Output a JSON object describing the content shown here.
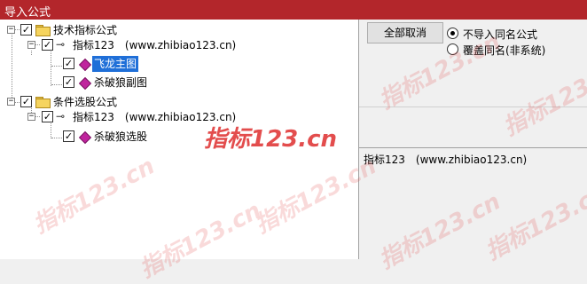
{
  "window": {
    "title": "导入公式"
  },
  "tree": {
    "nodes": [
      {
        "label": "技术指标公式"
      },
      {
        "label": "指标123　(www.zhibiao123.cn)"
      },
      {
        "label": "飞龙主图"
      },
      {
        "label": "杀破狼副图"
      },
      {
        "label": "条件选股公式"
      },
      {
        "label": "指标123　(www.zhibiao123.cn)"
      },
      {
        "label": "杀破狼选股"
      }
    ]
  },
  "actions": {
    "deselect_all_label": "全部取消"
  },
  "options": {
    "no_import_same_name": "不导入同名公式",
    "overwrite_same_name": "覆盖同名(非系统)",
    "selected": "no_import_same_name"
  },
  "info": {
    "text": "指标123　(www.zhibiao123.cn)"
  },
  "watermark": {
    "text": "指标123.cn",
    "color": "#e03a3a"
  }
}
